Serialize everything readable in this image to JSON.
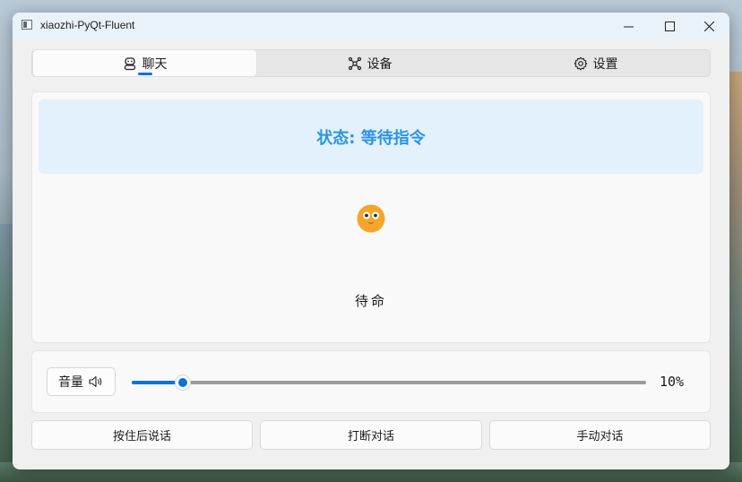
{
  "window": {
    "title": "xiaozhi-PyQt-Fluent"
  },
  "tabs": [
    {
      "label": "聊天",
      "icon": "robot-icon",
      "active": true
    },
    {
      "label": "设备",
      "icon": "network-icon",
      "active": false
    },
    {
      "label": "设置",
      "icon": "gear-icon",
      "active": false
    }
  ],
  "status": {
    "text": "状态: 等待指令",
    "color": "#2a95e6",
    "background": "#e3f1fd"
  },
  "emotion": {
    "icon": "owl-face-icon",
    "label": "待命"
  },
  "volume": {
    "label": "音量",
    "icon": "speaker-icon",
    "value_percent": 10,
    "value_text": "10%"
  },
  "actions": {
    "push_to_talk": "按住后说话",
    "interrupt": "打断对话",
    "manual": "手动对话"
  },
  "colors": {
    "accent": "#0a74d6"
  }
}
